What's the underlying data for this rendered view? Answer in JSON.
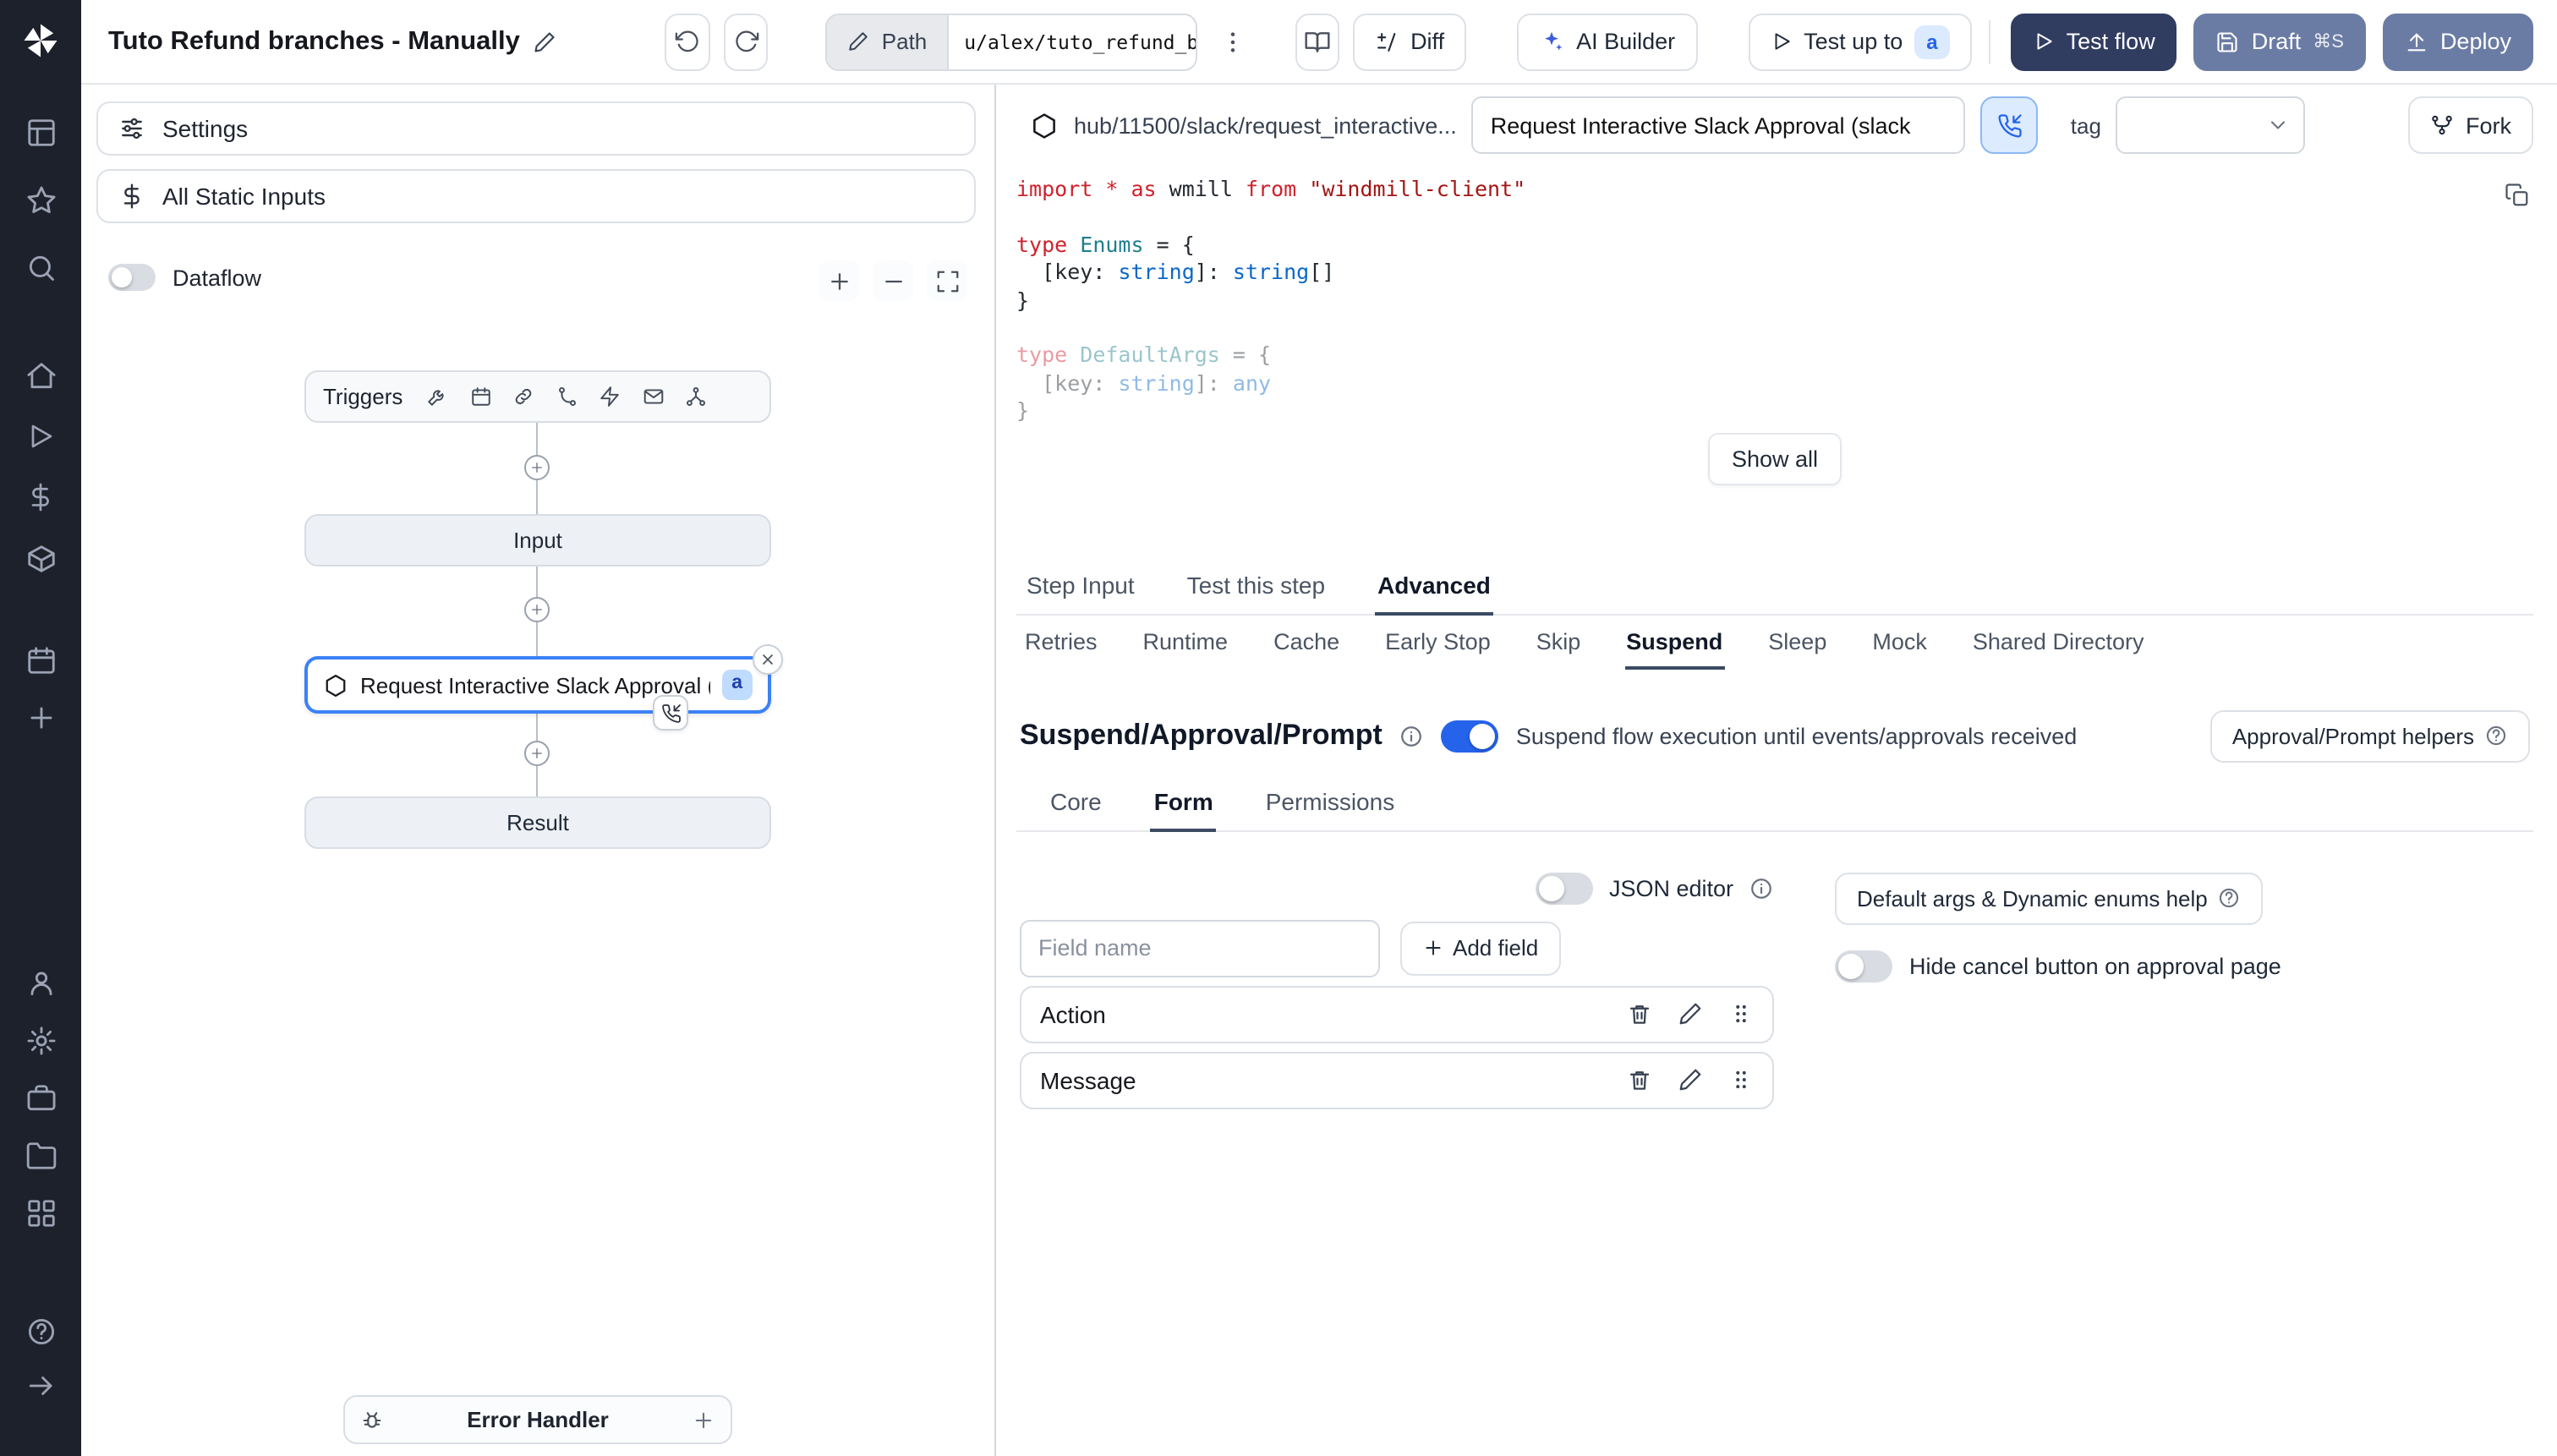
{
  "topbar": {
    "title": "Tuto Refund branches - Manually",
    "path_label": "Path",
    "path_value": "u/alex/tuto_refund_branches_",
    "diff_label": "Diff",
    "ai_builder_label": "AI Builder",
    "test_up_to_label": "Test up to",
    "test_up_to_badge": "a",
    "test_flow_label": "Test flow",
    "draft_label": "Draft",
    "draft_shortcut": "⌘S",
    "deploy_label": "Deploy"
  },
  "flow_panel": {
    "settings_label": "Settings",
    "static_inputs_label": "All Static Inputs",
    "dataflow_label": "Dataflow",
    "triggers_label": "Triggers",
    "input_node_label": "Input",
    "module_node_label": "Request Interactive Slack Approval (...",
    "module_badge": "a",
    "result_node_label": "Result",
    "error_handler_label": "Error Handler"
  },
  "editor": {
    "hub_path": "hub/11500/slack/request_interactive...",
    "summary_value": "Request Interactive Slack Approval (slack",
    "tag_label": "tag",
    "fork_label": "Fork",
    "show_all_label": "Show all",
    "code": [
      {
        "faded": false,
        "tokens": [
          [
            "kw",
            "import"
          ],
          [
            "pl",
            " "
          ],
          [
            "kw",
            "*"
          ],
          [
            "pl",
            " "
          ],
          [
            "kw",
            "as"
          ],
          [
            "pl",
            " wmill "
          ],
          [
            "kw",
            "from"
          ],
          [
            "pl",
            " "
          ],
          [
            "str",
            "\"windmill-client\""
          ]
        ]
      },
      {
        "faded": false,
        "tokens": []
      },
      {
        "faded": false,
        "tokens": [
          [
            "kw",
            "type"
          ],
          [
            "pl",
            " "
          ],
          [
            "ty",
            "Enums"
          ],
          [
            "pl",
            " = {"
          ]
        ]
      },
      {
        "faded": false,
        "tokens": [
          [
            "pl",
            "  [key: "
          ],
          [
            "pr",
            "string"
          ],
          [
            "pl",
            "]: "
          ],
          [
            "pr",
            "string"
          ],
          [
            "pl",
            "[]"
          ]
        ]
      },
      {
        "faded": false,
        "tokens": [
          [
            "pl",
            "}"
          ]
        ]
      },
      {
        "faded": false,
        "tokens": []
      },
      {
        "faded": true,
        "tokens": [
          [
            "kw",
            "type"
          ],
          [
            "pl",
            " "
          ],
          [
            "ty",
            "DefaultArgs"
          ],
          [
            "pl",
            " = {"
          ]
        ]
      },
      {
        "faded": true,
        "tokens": [
          [
            "pl",
            "  [key: "
          ],
          [
            "pr",
            "string"
          ],
          [
            "pl",
            "]: "
          ],
          [
            "pr",
            "any"
          ]
        ]
      },
      {
        "faded": true,
        "tokens": [
          [
            "pl",
            "}"
          ]
        ]
      }
    ]
  },
  "tabs": {
    "main": [
      "Step Input",
      "Test this step",
      "Advanced"
    ],
    "advanced": [
      "Retries",
      "Runtime",
      "Cache",
      "Early Stop",
      "Skip",
      "Suspend",
      "Sleep",
      "Mock",
      "Shared Directory"
    ]
  },
  "suspend": {
    "title": "Suspend/Approval/Prompt",
    "toggle_label": "Suspend flow execution until events/approvals received",
    "helpers_label": "Approval/Prompt helpers",
    "sub_tabs": [
      "Core",
      "Form",
      "Permissions"
    ],
    "json_editor_label": "JSON editor",
    "field_placeholder": "Field name",
    "add_field_label": "Add field",
    "args_help_label": "Default args & Dynamic enums help",
    "hide_cancel_label": "Hide cancel button on approval page",
    "fields": [
      "Action",
      "Message"
    ]
  }
}
